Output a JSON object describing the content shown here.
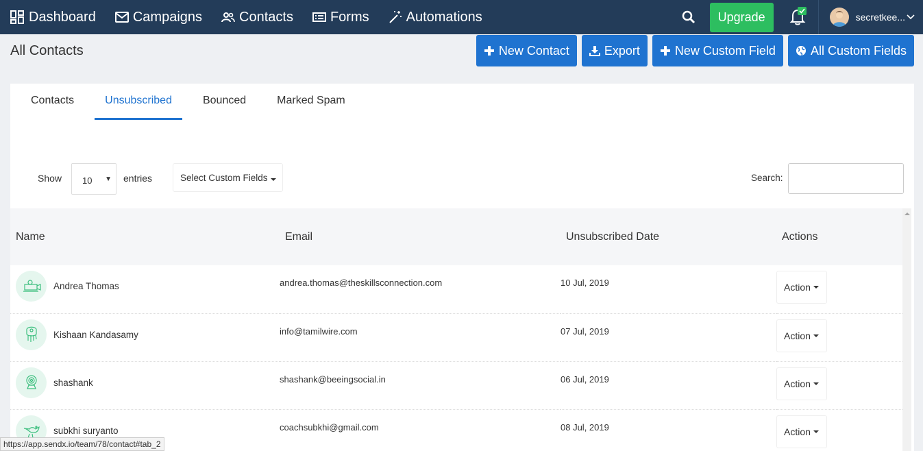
{
  "nav": {
    "items": [
      {
        "label": "Dashboard",
        "icon": "dashboard-icon"
      },
      {
        "label": "Campaigns",
        "icon": "envelope-icon"
      },
      {
        "label": "Contacts",
        "icon": "users-icon"
      },
      {
        "label": "Forms",
        "icon": "form-icon"
      },
      {
        "label": "Automations",
        "icon": "magic-wand-icon"
      }
    ],
    "upgrade_label": "Upgrade",
    "user_name": "secretkee..."
  },
  "page": {
    "title": "All Contacts",
    "buttons": {
      "new_contact": "New Contact",
      "export": "Export",
      "new_custom_field": "New Custom Field",
      "all_custom_fields": "All Custom Fields"
    }
  },
  "tabs": [
    {
      "label": "Contacts",
      "active": false
    },
    {
      "label": "Unsubscribed",
      "active": true
    },
    {
      "label": "Bounced",
      "active": false
    },
    {
      "label": "Marked Spam",
      "active": false
    }
  ],
  "controls": {
    "show_label": "Show",
    "entries_value": "10",
    "entries_label": "entries",
    "custom_fields_label": "Select Custom Fields",
    "search_label": "Search:",
    "search_value": ""
  },
  "table": {
    "headers": {
      "name": "Name",
      "email": "Email",
      "date": "Unsubscribed Date",
      "actions": "Actions"
    },
    "rows": [
      {
        "name": "Andrea Thomas",
        "email": "andrea.thomas@theskillsconnection.com",
        "date": "10 Jul, 2019",
        "action": "Action"
      },
      {
        "name": "Kishaan Kandasamy",
        "email": "info@tamilwire.com",
        "date": "07 Jul, 2019",
        "action": "Action"
      },
      {
        "name": "shashank",
        "email": "shashank@beeingsocial.in",
        "date": "06 Jul, 2019",
        "action": "Action"
      },
      {
        "name": "subkhi suryanto",
        "email": "coachsubkhi@gmail.com",
        "date": "08 Jul, 2019",
        "action": "Action"
      }
    ]
  },
  "status_url": "https://app.sendx.io/team/78/contact#tab_2",
  "colors": {
    "nav_bg": "#233c59",
    "primary": "#1f73d0",
    "success": "#2dbe60"
  }
}
